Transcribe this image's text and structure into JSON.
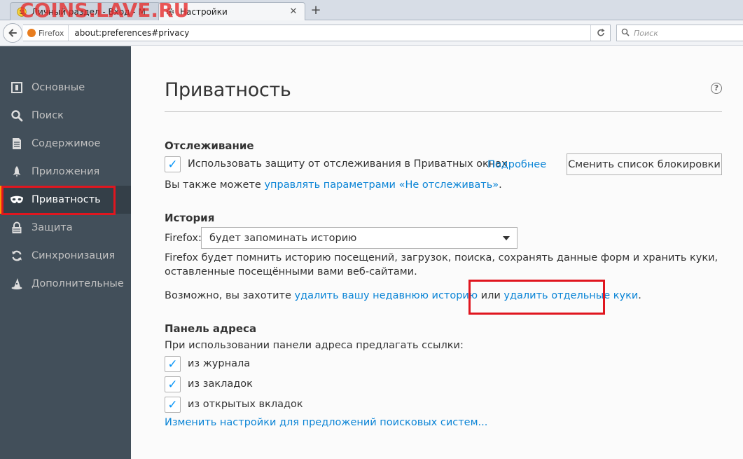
{
  "watermark": "COINS.LAVE.RU",
  "tabs": [
    {
      "label": "Личный раздел - Вход - М",
      "icon": "smiley-icon"
    },
    {
      "label": "Настройки",
      "icon": "gear-icon"
    }
  ],
  "navbar": {
    "identity_label": "Firefox",
    "url": "about:preferences#privacy",
    "search_placeholder": "Поиск"
  },
  "sidebar": {
    "items": [
      {
        "label": "Основные",
        "icon": "general-icon"
      },
      {
        "label": "Поиск",
        "icon": "search-icon"
      },
      {
        "label": "Содержимое",
        "icon": "content-icon"
      },
      {
        "label": "Приложения",
        "icon": "rocket-icon"
      },
      {
        "label": "Приватность",
        "icon": "mask-icon",
        "selected": true
      },
      {
        "label": "Защита",
        "icon": "lock-icon"
      },
      {
        "label": "Синхронизация",
        "icon": "sync-icon"
      },
      {
        "label": "Дополнительные",
        "icon": "wizard-hat-icon"
      }
    ]
  },
  "main": {
    "title": "Приватность",
    "tracking": {
      "heading": "Отслеживание",
      "checkbox_label": "Использовать защиту от отслеживания в Приватных окнах",
      "more_link": "Подробнее",
      "blocklist_button": "Сменить список блокировки",
      "dnt_prefix": "Вы также можете ",
      "dnt_link": "управлять параметрами «Не отслеживать»",
      "dnt_suffix": "."
    },
    "history": {
      "heading": "История",
      "firefox_label": "Firefox:",
      "mode_selected": "будет запоминать историю",
      "description_line1": "Firefox будет помнить историю посещений, загрузок, поиска, сохранять данные форм и хранить куки,",
      "description_line2": "оставленные посещёнными вами веб-сайтами.",
      "maybe_prefix": "Возможно, вы захотите ",
      "clear_link": "удалить вашу недавнюю историю",
      "or_text": " или ",
      "cookies_link": "удалить отдельные куки",
      "maybe_suffix": "."
    },
    "location_bar": {
      "heading": "Панель адреса",
      "intro": "При использовании панели адреса предлагать ссылки:",
      "options": [
        "из журнала",
        "из закладок",
        "из открытых вкладок"
      ],
      "search_suggest_link": "Изменить настройки для предложений поисковых систем..."
    }
  },
  "colors": {
    "sidebar_bg": "#424f5a",
    "link": "#0a84d6",
    "highlight_box": "#e0161f",
    "checkmark": "#0996f8"
  }
}
